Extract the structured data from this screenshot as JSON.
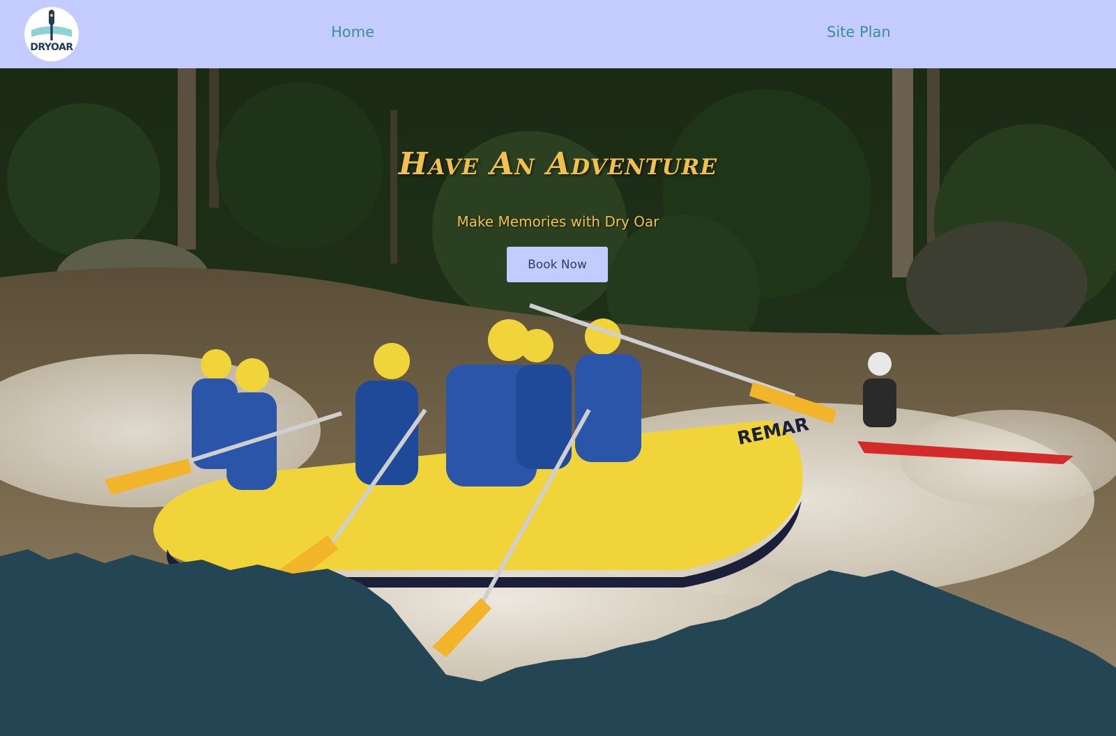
{
  "nav": {
    "logo_text": "DRYOAR",
    "links": [
      {
        "label": "Home"
      },
      {
        "label": "Site Plan"
      }
    ]
  },
  "hero": {
    "title": "Have An Adventure",
    "subtitle": "Make Memories with Dry Oar",
    "cta_label": "Book Now",
    "image_description": "whitewater-rafting-photo"
  },
  "colors": {
    "nav_bg": "#c3cbff",
    "nav_link": "#3e8f8e",
    "accent_gold": "#f2c04d",
    "footer_bg": "#244654",
    "button_text": "#2e3f58"
  }
}
